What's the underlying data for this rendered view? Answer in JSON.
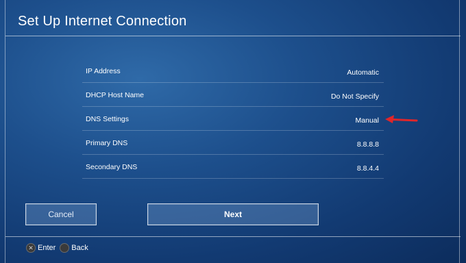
{
  "window": {
    "title": "Set Up Internet Connection"
  },
  "settings": [
    {
      "label": "IP Address",
      "value": "Automatic"
    },
    {
      "label": "DHCP Host Name",
      "value": "Do Not Specify"
    },
    {
      "label": "DNS Settings",
      "value": "Manual"
    },
    {
      "label": "Primary DNS",
      "value": "8.8.8.8"
    },
    {
      "label": "Secondary DNS",
      "value": "8.8.4.4"
    }
  ],
  "buttons": {
    "cancel": "Cancel",
    "next": "Next"
  },
  "hints": [
    {
      "icon": "cross-button-icon",
      "glyph": "✕",
      "label": "Enter"
    },
    {
      "icon": "circle-button-icon",
      "glyph": "",
      "label": "Back"
    }
  ],
  "colors": {
    "arrow": "#e0262a"
  }
}
